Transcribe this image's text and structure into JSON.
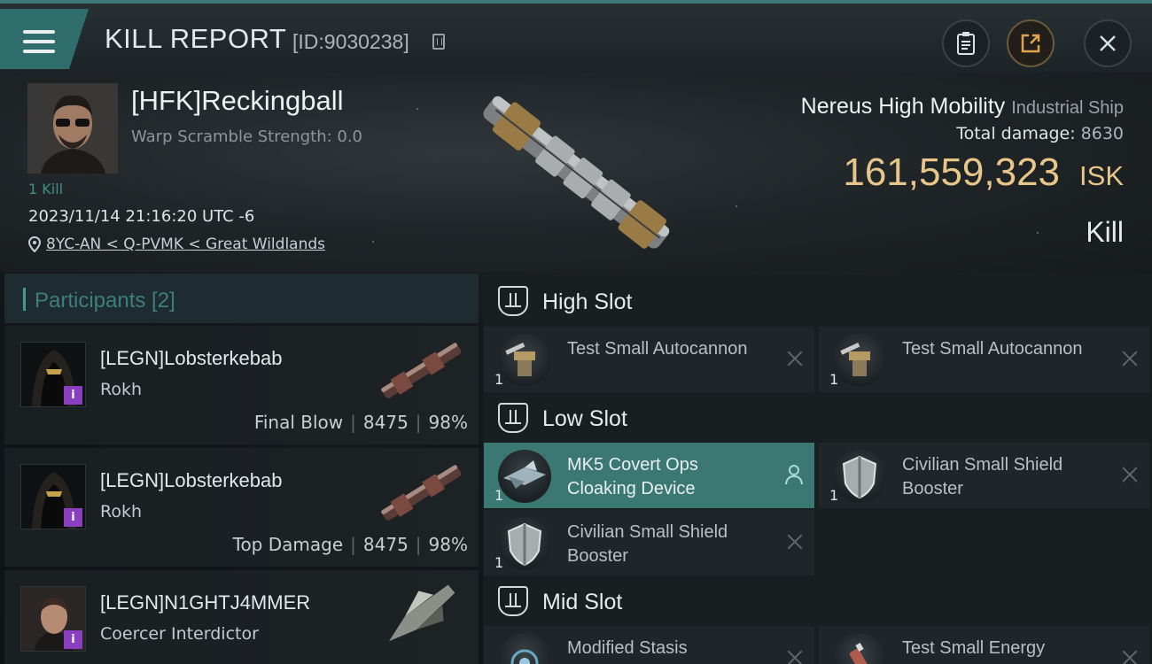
{
  "header": {
    "title": "KILL REPORT",
    "report_id": "[ID:9030238]"
  },
  "victim": {
    "name": "[HFK]Reckingball",
    "warp_scramble": "Warp Scramble Strength: 0.0",
    "kills": "1 Kill",
    "datetime": "2023/11/14 21:16:20 UTC -6",
    "location": "8YC-AN < Q-PVMK < Great Wildlands",
    "ship_name": "Nereus High Mobility",
    "ship_class": "Industrial Ship",
    "total_damage_label": "Total damage:",
    "total_damage": "8630",
    "isk_value": "161,559,323",
    "isk_unit": "ISK",
    "result": "Kill"
  },
  "participants": {
    "header": "Participants [2]",
    "items": [
      {
        "name": "[LEGN]Lobsterkebab",
        "ship": "Rokh",
        "role": "Final Blow",
        "damage": "8475",
        "percent": "98%"
      },
      {
        "name": "[LEGN]Lobsterkebab",
        "ship": "Rokh",
        "role": "Top Damage",
        "damage": "8475",
        "percent": "98%"
      },
      {
        "name": "[LEGN]N1GHTJ4MMER",
        "ship": "Coercer Interdictor"
      }
    ]
  },
  "slots": {
    "high": {
      "title": "High Slot",
      "modules": [
        {
          "qty": "1",
          "name": "Test Small Autocannon"
        },
        {
          "qty": "1",
          "name": "Test Small Autocannon"
        }
      ]
    },
    "low": {
      "title": "Low Slot",
      "modules": [
        {
          "qty": "1",
          "name": "MK5 Covert Ops Cloaking Device"
        },
        {
          "qty": "1",
          "name": "Civilian Small Shield Booster"
        },
        {
          "qty": "1",
          "name": "Civilian Small Shield Booster"
        }
      ]
    },
    "mid": {
      "title": "Mid Slot",
      "modules": [
        {
          "name": "Modified Stasis"
        },
        {
          "name": "Test Small Energy"
        }
      ]
    }
  },
  "icons": {
    "menu": "menu-icon",
    "copy": "copy-icon",
    "clipboard": "clipboard-icon",
    "share": "share-icon",
    "close": "close-icon",
    "location": "location-pin-icon",
    "slot": "slot-icon",
    "remove": "x-icon",
    "person": "person-icon"
  },
  "colors": {
    "accent": "#3f7a78",
    "isk": "#e8c68a",
    "highlight_module": "#3b7773",
    "corp_badge": "#8a3fc0"
  }
}
